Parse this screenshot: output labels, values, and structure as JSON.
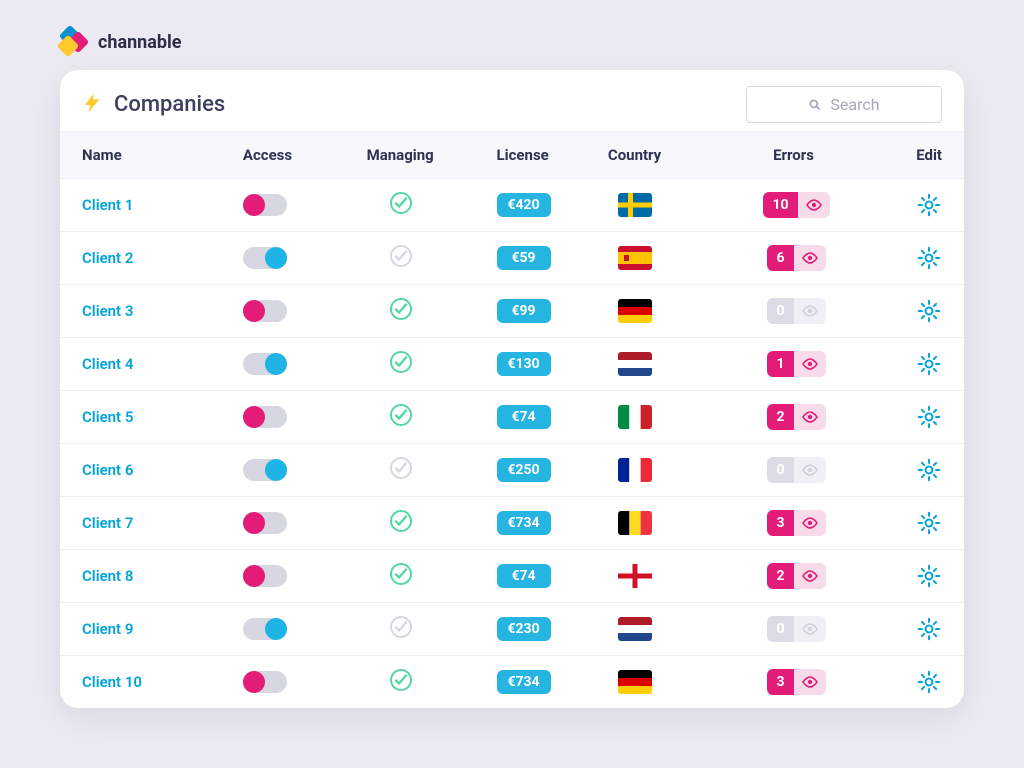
{
  "brand": {
    "name": "channable"
  },
  "page": {
    "title": "Companies"
  },
  "search": {
    "placeholder": "Search"
  },
  "columns": {
    "name": "Name",
    "access": "Access",
    "managing": "Managing",
    "license": "License",
    "country": "Country",
    "errors": "Errors",
    "edit": "Edit"
  },
  "rows": [
    {
      "name": "Client 1",
      "access": "pink",
      "managing": true,
      "license": "€420",
      "country": "sweden",
      "errors": 10
    },
    {
      "name": "Client 2",
      "access": "blue",
      "managing": false,
      "license": "€59",
      "country": "spain",
      "errors": 6
    },
    {
      "name": "Client 3",
      "access": "pink",
      "managing": true,
      "license": "€99",
      "country": "germany",
      "errors": 0
    },
    {
      "name": "Client 4",
      "access": "blue",
      "managing": true,
      "license": "€130",
      "country": "netherlands",
      "errors": 1
    },
    {
      "name": "Client 5",
      "access": "pink",
      "managing": true,
      "license": "€74",
      "country": "italy",
      "errors": 2
    },
    {
      "name": "Client 6",
      "access": "blue",
      "managing": false,
      "license": "€250",
      "country": "france",
      "errors": 0
    },
    {
      "name": "Client 7",
      "access": "pink",
      "managing": true,
      "license": "€734",
      "country": "belgium",
      "errors": 3
    },
    {
      "name": "Client 8",
      "access": "pink",
      "managing": true,
      "license": "€74",
      "country": "england",
      "errors": 2
    },
    {
      "name": "Client 9",
      "access": "blue",
      "managing": false,
      "license": "€230",
      "country": "netherlands",
      "errors": 0
    },
    {
      "name": "Client 10",
      "access": "pink",
      "managing": true,
      "license": "€734",
      "country": "germany",
      "errors": 3
    }
  ]
}
